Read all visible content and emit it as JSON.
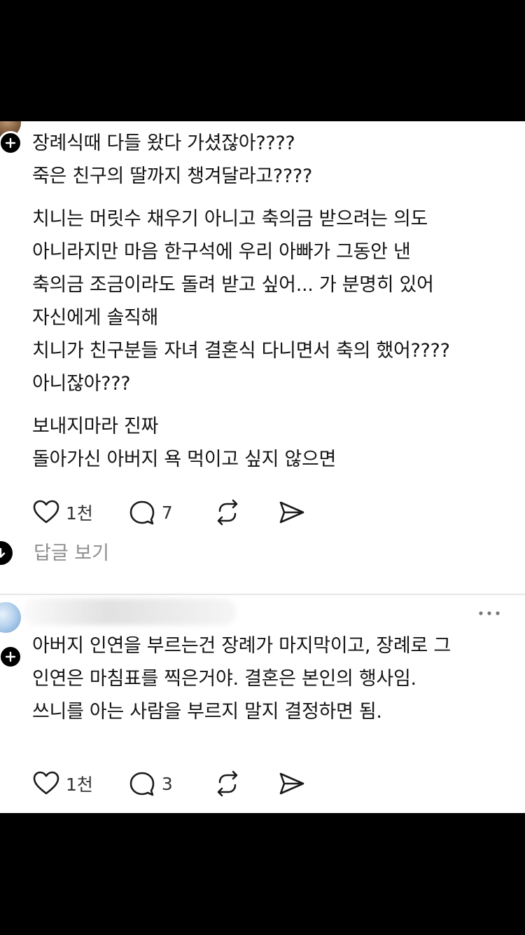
{
  "post1": {
    "paragraphs": [
      [
        "장례식때 다들 왔다 가셨잖아????",
        "죽은 친구의 딸까지 챙겨달라고????"
      ],
      [
        "치니는 머릿수 채우기 아니고 축의금 받으려는 의도",
        "아니라지만 마음 한구석에 우리 아빠가 그동안 낸",
        "축의금 조금이라도 돌려 받고 싶어... 가 분명히 있어",
        "자신에게 솔직해",
        "치니가 친구분들 자녀 결혼식 다니면서 축의 했어????",
        "아니잖아???"
      ],
      [
        "보내지마라 진짜",
        "돌아가신 아버지 욕 먹이고 싶지 않으면"
      ]
    ],
    "likes": "1천",
    "comments": "7",
    "view_replies_label": "답글 보기"
  },
  "post2": {
    "lines": [
      "아버지 인연을 부르는건 장례가 마지막이고, 장례로 그",
      "인연은 마침표를 찍은거야. 결혼은 본인의 행사임.",
      "쓰니를 아는 사람을 부르지 말지 결정하면 됨."
    ],
    "likes": "1천",
    "comments": "3"
  },
  "icons": {
    "like": "heart-icon",
    "comment": "speech-bubble-icon",
    "repost": "repost-icon",
    "share": "send-icon",
    "more": "more-dots-icon",
    "follow": "plus-icon",
    "expand": "arrow-down-icon"
  },
  "colors": {
    "text": "#141414",
    "muted": "#8e8e8e",
    "background": "#ffffff",
    "divider": "#e6e6e6"
  }
}
